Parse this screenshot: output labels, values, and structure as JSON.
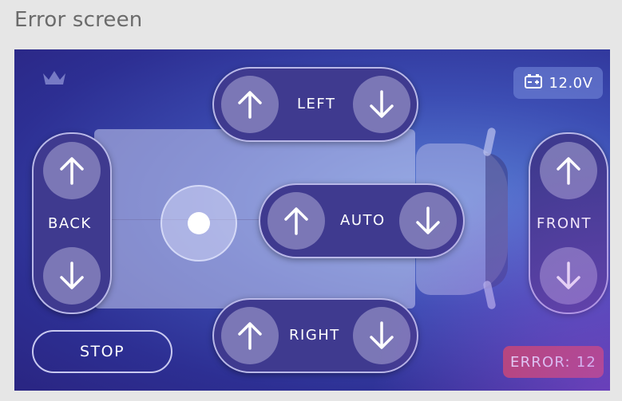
{
  "header": {
    "title": "Error screen"
  },
  "status": {
    "voltage": "12.0V",
    "error": "ERROR: 12"
  },
  "controls": {
    "left": {
      "label": "LEFT"
    },
    "back": {
      "label": "BACK"
    },
    "auto": {
      "label": "AUTO"
    },
    "front": {
      "label": "FRONT"
    },
    "right": {
      "label": "RIGHT"
    },
    "stop": {
      "label": "STOP"
    }
  },
  "icons": {
    "crown": "crown-icon",
    "battery": "battery-icon",
    "up": "arrow-up-icon",
    "down": "arrow-down-icon"
  },
  "colors": {
    "panel": "#3c4db3",
    "group_bg": "#3f3a8f",
    "button_bg": "#7b77b6",
    "error_badge": "#c0425c",
    "voltage_badge": "#7f8fd8"
  }
}
